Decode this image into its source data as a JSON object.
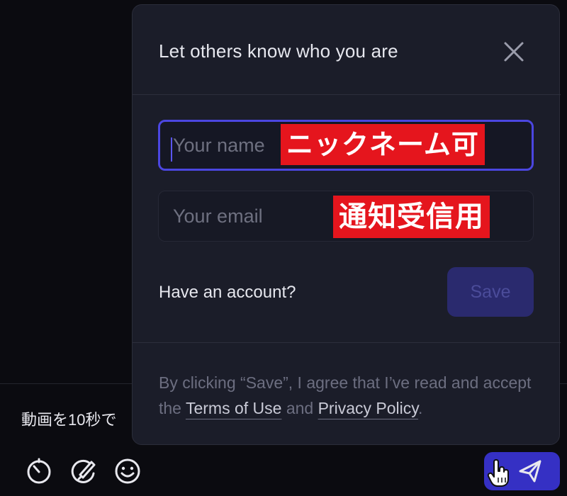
{
  "modal": {
    "title": "Let others know who you are",
    "name_placeholder": "Your name",
    "email_placeholder": "Your email",
    "account_link": "Have an account?",
    "save_label": "Save",
    "legal_prefix": "By clicking “Save”, I agree that I’ve read and accept the ",
    "terms_label": "Terms of Use",
    "legal_middle": " and ",
    "privacy_label": "Privacy Policy",
    "legal_suffix": "."
  },
  "annotations": {
    "name_note": "ニックネーム可",
    "email_note": "通知受信用"
  },
  "composer": {
    "text": "動画を10秒で"
  },
  "icons": {
    "close": "close-icon",
    "timer": "timer-icon",
    "draw": "draw-icon",
    "emoji": "emoji-icon",
    "send": "send-icon",
    "cursor": "hand-cursor-icon"
  },
  "colors": {
    "background": "#0b0b10",
    "modal": "#1b1d29",
    "accent": "#4b46e0",
    "send_button": "#3530c4",
    "annotation": "#e5151d"
  }
}
